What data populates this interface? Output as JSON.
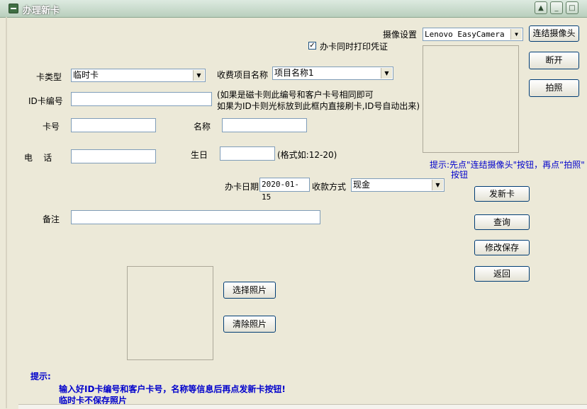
{
  "window": {
    "title": "办理新卡",
    "buttons": [
      "▲",
      "_",
      "□",
      "×"
    ]
  },
  "camera": {
    "label": "摄像设置",
    "device": "Lenovo EasyCamera",
    "connect_button": "连结摄像头",
    "disconnect_button": "断开",
    "capture_button": "拍照",
    "hint": "提示:先点\"连结摄像头\"按钮，再点“拍照\"",
    "hint_line2": "按钮"
  },
  "print_receipt": {
    "label": "办卡同时打印凭证",
    "checked": true
  },
  "form": {
    "card_type_label": "卡类型",
    "card_type_value": "临时卡",
    "fee_item_label": "收费项目名称",
    "fee_item_value": "项目名称1",
    "id_card_label": "ID卡编号",
    "id_card_value": "",
    "id_note_1": "(如果是磁卡则此编号和客户卡号相同即可",
    "id_note_2": "如果为ID卡则光标放到此框内直接刷卡,ID号自动出来)",
    "card_no_label": "卡号",
    "card_no_value": "",
    "name_label": "名称",
    "name_value": "",
    "phone_label": "电    话",
    "phone_value": "",
    "birthday_label": "生日",
    "birthday_value": "",
    "birthday_format": "(格式如:12-20)",
    "issue_date_label": "办卡日期",
    "issue_date_value": "2020-01-15",
    "payment_label": "收款方式",
    "payment_value": "现金",
    "remark_label": "备注",
    "remark_value": ""
  },
  "actions": {
    "issue": "发新卡",
    "query": "查询",
    "save": "修改保存",
    "back": "返回"
  },
  "photo": {
    "select": "选择照片",
    "clear": "清除照片"
  },
  "footer": {
    "title": "提示:",
    "line1": "输入好ID卡编号和客户卡号，名称等信息后再点发新卡按钮!",
    "line2": "临时卡不保存照片"
  }
}
